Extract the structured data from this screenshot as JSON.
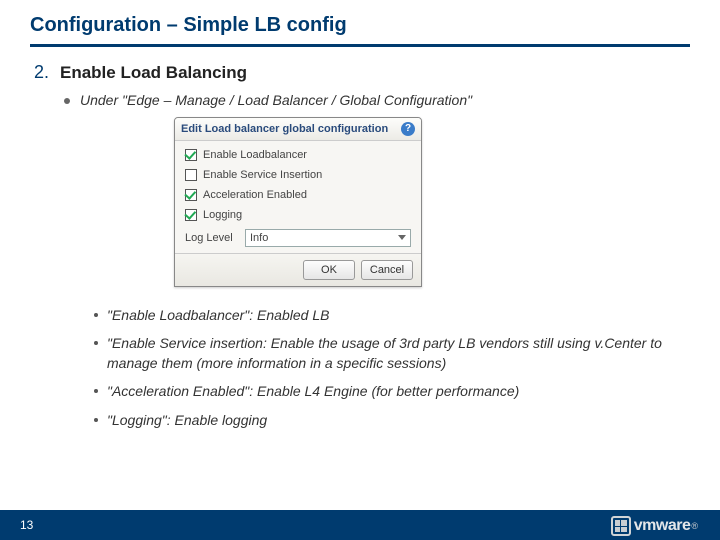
{
  "title": "Configuration – Simple LB config",
  "step": {
    "num": "2.",
    "title": "Enable Load Balancing"
  },
  "sub1": "Under \"Edge – Manage / Load Balancer /  Global Configuration\"",
  "dialog": {
    "title": "Edit Load balancer global configuration",
    "help": "?",
    "checks": [
      {
        "label": "Enable Loadbalancer",
        "checked": true
      },
      {
        "label": "Enable Service Insertion",
        "checked": false
      },
      {
        "label": "Acceleration Enabled",
        "checked": true
      },
      {
        "label": "Logging",
        "checked": true
      }
    ],
    "loglevel_label": "Log Level",
    "loglevel_value": "Info",
    "ok": "OK",
    "cancel": "Cancel"
  },
  "subs": [
    "\"Enable Loadbalancer\": Enabled LB",
    "\"Enable Service insertion: Enable the usage of 3rd party LB vendors still using v.Center to manage them (more information in a specific sessions)",
    "\"Acceleration Enabled\": Enable L4 Engine (for better performance)",
    "\"Logging\": Enable logging"
  ],
  "page": "13",
  "brand": "vmware",
  "reg": "®"
}
